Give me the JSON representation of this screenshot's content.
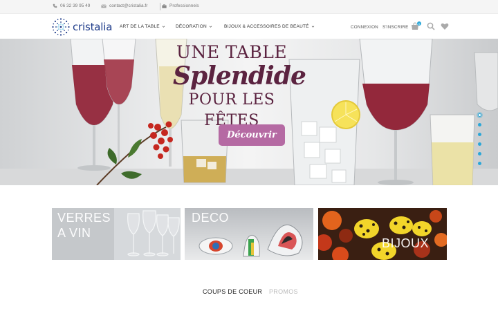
{
  "topbar": {
    "phone": "06 32 39 95 49",
    "email": "contact@cristalia.fr",
    "pro": "Professionnels"
  },
  "header": {
    "logo_text": "cristalia",
    "nav": [
      {
        "label": "ART DE LA TABLE"
      },
      {
        "label": "DÉCORATION"
      },
      {
        "label": "BIJOUX & ACCESSOIRES DE BEAUTÉ"
      }
    ],
    "login": "CONNEXION",
    "register": "S'INSCRIRE",
    "cart_count": "0",
    "icons": [
      "cart-icon",
      "search-icon",
      "heart-icon"
    ]
  },
  "hero": {
    "line1": "UNE TABLE",
    "line2": "Splendide",
    "line3": "POUR LES FÊTES",
    "cta": "Découvrir",
    "slide_count": 6,
    "accent_color": "#b56aa3",
    "title_color": "#5b2340"
  },
  "categories": [
    {
      "line1": "VERRES",
      "line2": "A VIN"
    },
    {
      "line1": "DECO",
      "line2": ""
    },
    {
      "line1": "BIJOUX",
      "line2": ""
    }
  ],
  "tabs": [
    {
      "label": "COUPS DE COEUR",
      "active": true
    },
    {
      "label": "PROMOS",
      "active": false
    }
  ],
  "colors": {
    "brand_blue": "#1f3c8a",
    "accent_blue": "#2aa7d8"
  }
}
